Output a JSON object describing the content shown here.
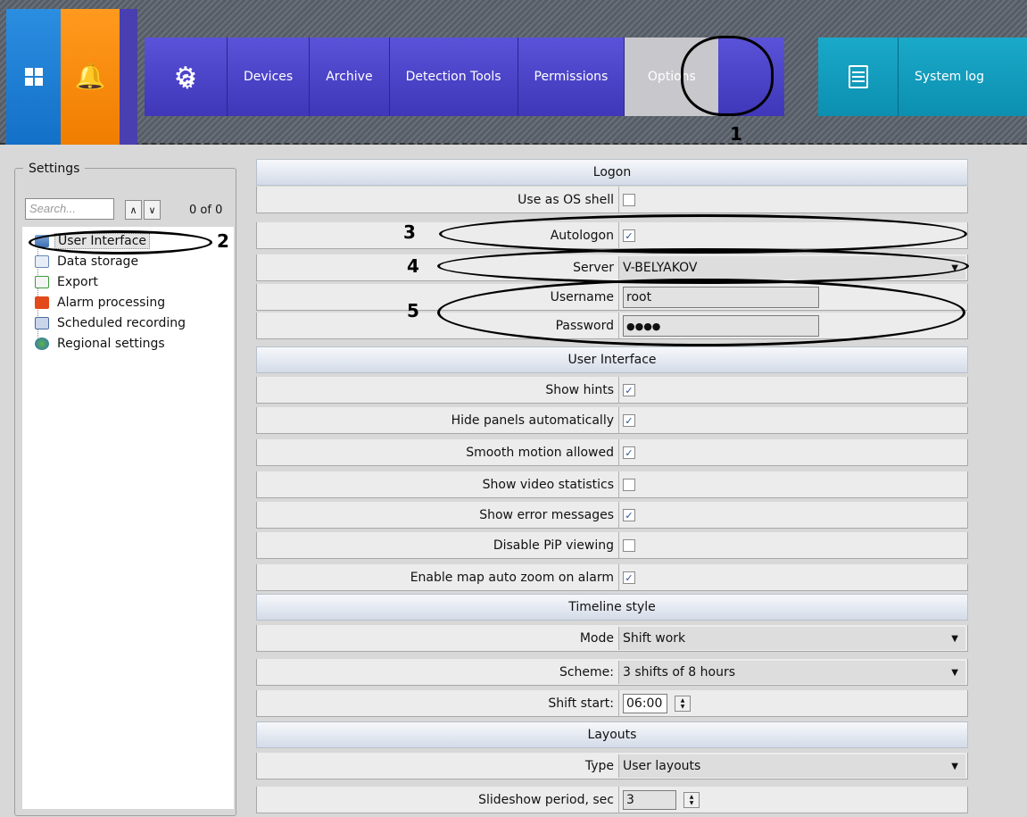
{
  "toolbar": {
    "nav": [
      "Devices",
      "Archive",
      "Detection Tools",
      "Permissions",
      "Options"
    ],
    "system_log": "System log",
    "colors": {
      "blue_tile": "#1f80d6",
      "orange_tile": "#f5870a",
      "nav_bg": "#4a43c8",
      "log_bg": "#149ec0"
    }
  },
  "annotations": {
    "n1": "1",
    "n2": "2",
    "n3": "3",
    "n4": "4",
    "n5": "5"
  },
  "settings": {
    "legend": "Settings",
    "search_placeholder": "Search...",
    "count": "0 of 0",
    "tree": [
      "User Interface",
      "Data storage",
      "Export",
      "Alarm processing",
      "Scheduled recording",
      "Regional settings"
    ]
  },
  "grid": {
    "logon": {
      "title": "Logon",
      "use_os_shell": "Use as OS shell",
      "autologon": "Autologon",
      "server": "Server",
      "server_value": "V-BELYAKOV",
      "username": "Username",
      "username_value": "root",
      "password": "Password",
      "password_value": "●●●●"
    },
    "ui": {
      "title": "User Interface",
      "show_hints": "Show hints",
      "hide_panels": "Hide panels automatically",
      "smooth_motion": "Smooth motion allowed",
      "show_video_stats": "Show video statistics",
      "show_errors": "Show error messages",
      "disable_pip": "Disable PiP viewing",
      "map_zoom": "Enable map auto zoom on alarm"
    },
    "timeline": {
      "title": "Timeline style",
      "mode": "Mode",
      "mode_value": "Shift work",
      "scheme": "Scheme:",
      "scheme_value": "3 shifts of 8 hours",
      "shift_start": "Shift start:",
      "shift_start_value": "06:00"
    },
    "layouts": {
      "title": "Layouts",
      "type": "Type",
      "type_value": "User layouts",
      "slideshow": "Slideshow period, sec",
      "slideshow_value": "3"
    }
  }
}
